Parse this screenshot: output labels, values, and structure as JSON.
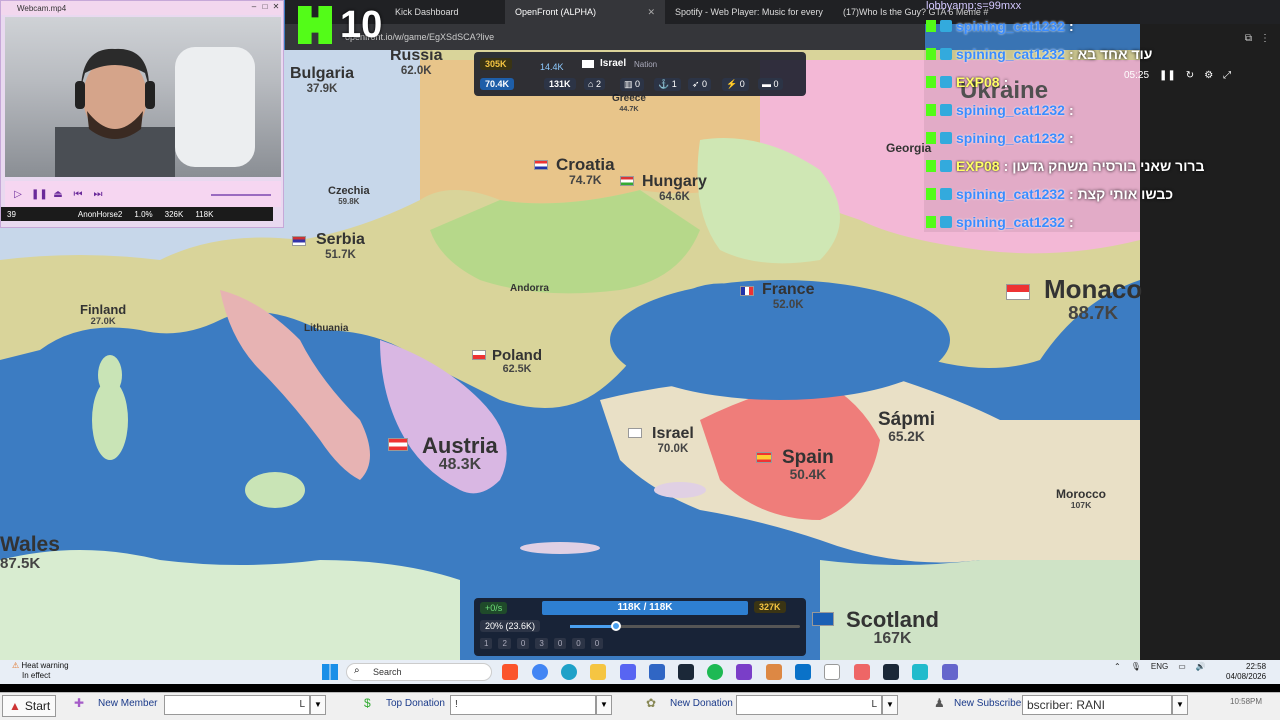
{
  "browser": {
    "tabs": [
      {
        "label": "Kick Dashboard"
      },
      {
        "label": "OpenFront (ALPHA)"
      },
      {
        "label": "Spotify - Web Player: Music for every"
      },
      {
        "label": "(17)Who Is the Guy? GTA 6 Meme #"
      }
    ],
    "address": "openfront.io/w/game/EgXSdSCA?live"
  },
  "kick_overlay": {
    "count": "10"
  },
  "webcam": {
    "title": "Webcam.mp4",
    "stats": [
      "39",
      "AnonHorse2",
      "1.0%",
      "326K",
      "118K"
    ]
  },
  "hud_top": {
    "gold": "305K",
    "gold_rate": "14.4K",
    "nation": "Israel",
    "nation_type": "Nation",
    "troops": "70.4K",
    "capacity": "131K",
    "buildings": [
      "2",
      "0",
      "1",
      "0",
      "0",
      "0"
    ]
  },
  "hud_bottom": {
    "pop_rate": "+0/s",
    "population": "118K / 118K",
    "gold": "327K",
    "attack_ratio": "20% (23.6K)",
    "attack_ratio_fraction": 0.2,
    "build_slots": [
      "1",
      "2",
      "0",
      "3",
      "0",
      "0",
      "0"
    ]
  },
  "chat": {
    "top": "lobbyamp;s=99mxx",
    "video_time": "05:25",
    "messages": [
      {
        "user": "spining_cat1232",
        "text": ""
      },
      {
        "user": "spining_cat1232",
        "text": "עוד אחד בא"
      },
      {
        "user": "EXP08",
        "text": ""
      },
      {
        "user": "spining_cat1232",
        "text": ""
      },
      {
        "user": "spining_cat1232",
        "text": ""
      },
      {
        "user": "EXP08",
        "text": "ברור שאני בורסיה משחק גדעון"
      },
      {
        "user": "spining_cat1232",
        "text": "כבשו אותי קצת"
      },
      {
        "user": "spining_cat1232",
        "text": ""
      }
    ]
  },
  "countries": [
    {
      "name": "Bulgaria",
      "value": "37.9K"
    },
    {
      "name": "Russia",
      "value": "62.0K"
    },
    {
      "name": "Greece",
      "value": "44.7K"
    },
    {
      "name": "Croatia",
      "value": "74.7K"
    },
    {
      "name": "Hungary",
      "value": "64.6K"
    },
    {
      "name": "Georgia",
      "value": ""
    },
    {
      "name": "Ukraine",
      "value": ""
    },
    {
      "name": "Czechia",
      "value": "59.8K"
    },
    {
      "name": "Serbia",
      "value": "51.7K"
    },
    {
      "name": "Andorra",
      "value": ""
    },
    {
      "name": "France",
      "value": "52.0K"
    },
    {
      "name": "Monaco",
      "value": "88.7K"
    },
    {
      "name": "Finland",
      "value": "27.0K"
    },
    {
      "name": "Lithuania",
      "value": ""
    },
    {
      "name": "Poland",
      "value": "62.5K"
    },
    {
      "name": "Austria",
      "value": "48.3K"
    },
    {
      "name": "Israel",
      "value": "70.0K"
    },
    {
      "name": "Sápmi",
      "value": "65.2K"
    },
    {
      "name": "Spain",
      "value": "50.4K"
    },
    {
      "name": "Morocco",
      "value": "107K"
    },
    {
      "name": "Wales",
      "value": "87.5K"
    },
    {
      "name": "Scotland",
      "value": "167K"
    }
  ],
  "taskbar": {
    "heat_title": "Heat warning",
    "heat_sub": "In effect",
    "search": "Search",
    "lang": "ENG",
    "time": "22:58",
    "date": "04/08/2026"
  },
  "stream_bar": {
    "start": "Start",
    "new_member": "New Member",
    "top_donation": "Top Donation",
    "new_donation": "New Donation",
    "new_subscriber": "New Subscriber",
    "field1": "L",
    "field2": "!",
    "field3": "L",
    "field4": "bscriber: RANI",
    "stream_time": "10:58PM"
  },
  "colors": {
    "sea": "#3c7cc2",
    "kick_green": "#53fc18",
    "hud_bg": "#141a28",
    "troop_blue": "#2e7fd1"
  }
}
